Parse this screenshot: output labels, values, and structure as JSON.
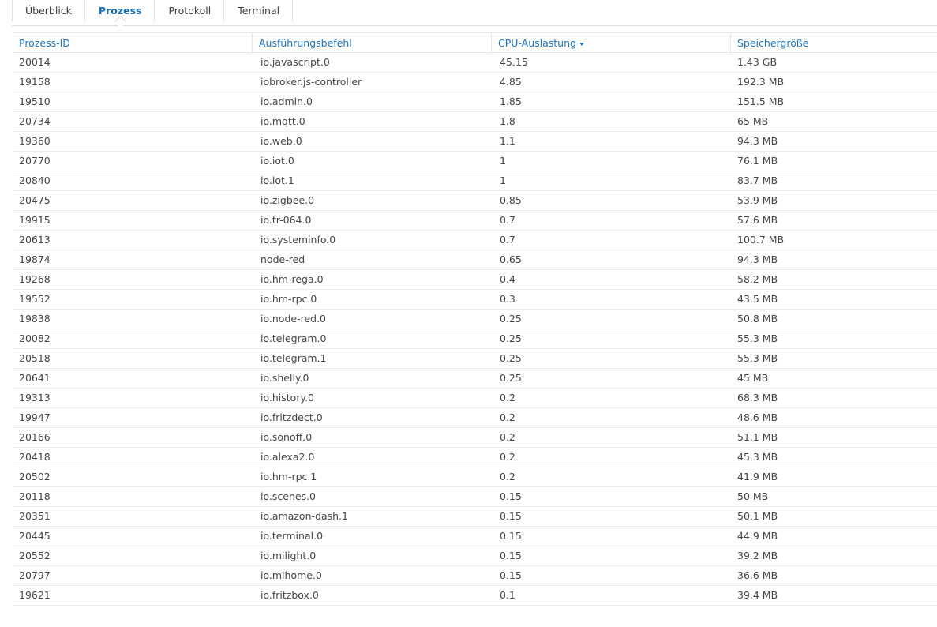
{
  "tabs": [
    {
      "label": "Überblick",
      "active": false
    },
    {
      "label": "Prozess",
      "active": true
    },
    {
      "label": "Protokoll",
      "active": false
    },
    {
      "label": "Terminal",
      "active": false
    }
  ],
  "table": {
    "columns": [
      "Prozess-ID",
      "Ausführungsbefehl",
      "CPU-Auslastung",
      "Speichergröße"
    ],
    "sorted_column": "CPU-Auslastung",
    "sort_direction": "descending",
    "rows": [
      [
        "20014",
        "io.javascript.0",
        "45.15",
        "1.43 GB"
      ],
      [
        "19158",
        "iobroker.js-controller",
        "4.85",
        "192.3 MB"
      ],
      [
        "19510",
        "io.admin.0",
        "1.85",
        "151.5 MB"
      ],
      [
        "20734",
        "io.mqtt.0",
        "1.8",
        "65 MB"
      ],
      [
        "19360",
        "io.web.0",
        "1.1",
        "94.3 MB"
      ],
      [
        "20770",
        "io.iot.0",
        "1",
        "76.1 MB"
      ],
      [
        "20840",
        "io.iot.1",
        "1",
        "83.7 MB"
      ],
      [
        "20475",
        "io.zigbee.0",
        "0.85",
        "53.9 MB"
      ],
      [
        "19915",
        "io.tr-064.0",
        "0.7",
        "57.6 MB"
      ],
      [
        "20613",
        "io.systeminfo.0",
        "0.7",
        "100.7 MB"
      ],
      [
        "19874",
        "node-red",
        "0.65",
        "94.3 MB"
      ],
      [
        "19268",
        "io.hm-rega.0",
        "0.4",
        "58.2 MB"
      ],
      [
        "19552",
        "io.hm-rpc.0",
        "0.3",
        "43.5 MB"
      ],
      [
        "19838",
        "io.node-red.0",
        "0.25",
        "50.8 MB"
      ],
      [
        "20082",
        "io.telegram.0",
        "0.25",
        "55.3 MB"
      ],
      [
        "20518",
        "io.telegram.1",
        "0.25",
        "55.3 MB"
      ],
      [
        "20641",
        "io.shelly.0",
        "0.25",
        "45 MB"
      ],
      [
        "19313",
        "io.history.0",
        "0.2",
        "68.3 MB"
      ],
      [
        "19947",
        "io.fritzdect.0",
        "0.2",
        "48.6 MB"
      ],
      [
        "20166",
        "io.sonoff.0",
        "0.2",
        "51.1 MB"
      ],
      [
        "20418",
        "io.alexa2.0",
        "0.2",
        "45.3 MB"
      ],
      [
        "20502",
        "io.hm-rpc.1",
        "0.2",
        "41.9 MB"
      ],
      [
        "20118",
        "io.scenes.0",
        "0.15",
        "50 MB"
      ],
      [
        "20351",
        "io.amazon-dash.1",
        "0.15",
        "50.1 MB"
      ],
      [
        "20445",
        "io.terminal.0",
        "0.15",
        "44.9 MB"
      ],
      [
        "20552",
        "io.milight.0",
        "0.15",
        "39.2 MB"
      ],
      [
        "20797",
        "io.mihome.0",
        "0.15",
        "36.6 MB"
      ],
      [
        "19621",
        "io.fritzbox.0",
        "0.1",
        "39.4 MB"
      ]
    ]
  },
  "colors": {
    "accent": "#1e73be",
    "text": "#444444",
    "border": "#e3e7ec"
  }
}
